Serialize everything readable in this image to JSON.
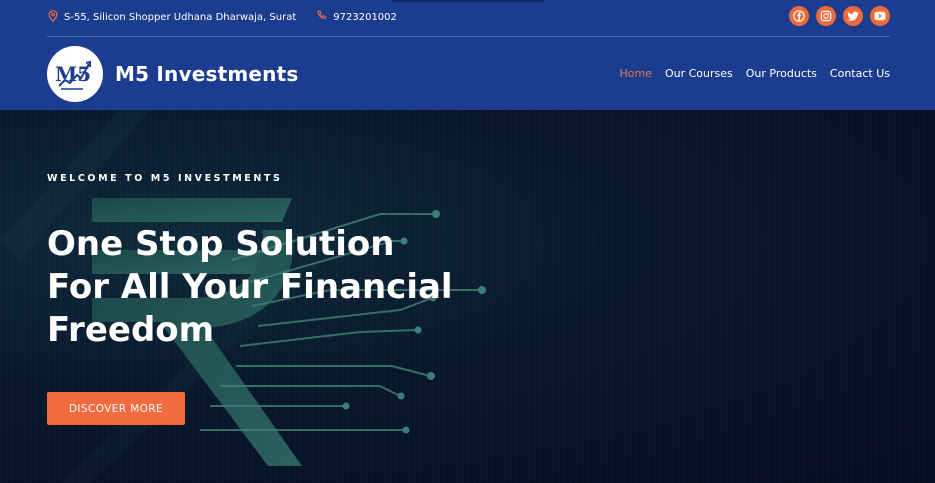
{
  "topbar": {
    "address": "S-55, Silicon Shopper Udhana Dharwaja, Surat",
    "phone": "9723201002",
    "social": [
      "facebook-icon",
      "instagram-icon",
      "twitter-icon",
      "youtube-icon"
    ]
  },
  "brand": {
    "logo_text": "M5",
    "name": "M5 Investments"
  },
  "nav": {
    "items": [
      "Home",
      "Our Courses",
      "Our Products",
      "Contact Us"
    ],
    "active": "Home"
  },
  "hero": {
    "eyebrow": "WELCOME TO M5 INVESTMENTS",
    "headline_lines": [
      "One Stop Solution",
      "For All Your Financial",
      "Freedom"
    ],
    "cta": "DISCOVER MORE"
  },
  "colors": {
    "header_bg": "#1b3c8f",
    "accent": "#f26a3e",
    "hero_bg": "#07142e",
    "circuit": "#3f7d75"
  }
}
